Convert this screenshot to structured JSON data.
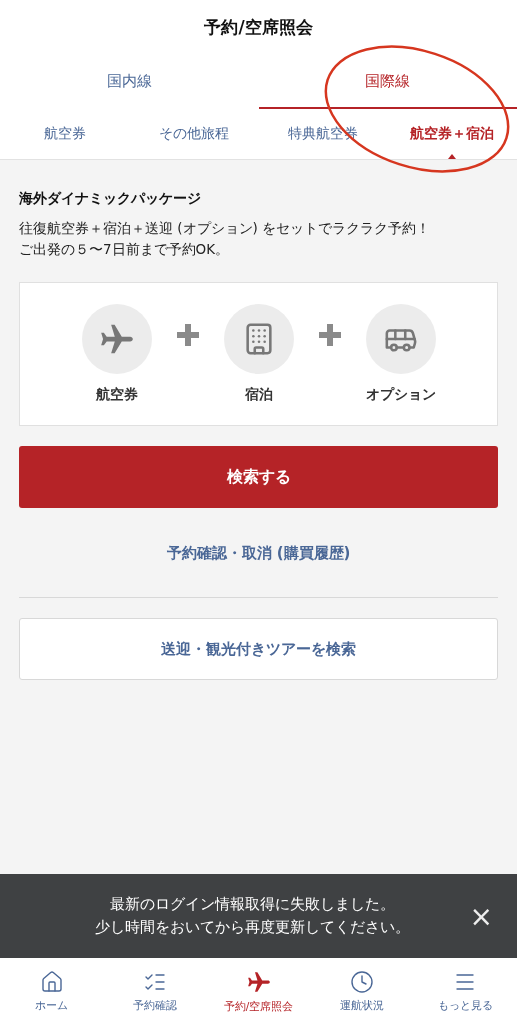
{
  "header": {
    "title": "予約/空席照会"
  },
  "tabs": [
    {
      "label": "国内線",
      "selected": false
    },
    {
      "label": "国際線",
      "selected": true
    }
  ],
  "subtabs": [
    {
      "label": "航空券",
      "selected": false
    },
    {
      "label": "その他旅程",
      "selected": false
    },
    {
      "label": "特典航空券",
      "selected": false
    },
    {
      "label": "航空券＋宿泊",
      "selected": true
    }
  ],
  "package": {
    "title": "海外ダイナミックパッケージ",
    "description": [
      "往復航空券＋宿泊＋送迎 (オプション) をセットでラクラク予約！",
      "ご出発の５〜7日前まで予約OK。"
    ],
    "items": [
      {
        "kind": "plane",
        "label": "航空券"
      },
      {
        "kind": "building",
        "label": "宿泊"
      },
      {
        "kind": "bus",
        "label": "オプション"
      }
    ]
  },
  "search_button": "検索する",
  "history_link": "予約確認・取消 (購買履歴)",
  "tour_button": "送迎・観光付きツアーを検索",
  "toast": {
    "message": [
      "最新のログイン情報取得に失敗しました。",
      "少し時間をおいてから再度更新してください。"
    ],
    "close": "×"
  },
  "nav": [
    {
      "kind": "home",
      "label": "ホーム",
      "selected": false
    },
    {
      "kind": "list",
      "label": "予約確認",
      "selected": false
    },
    {
      "kind": "plane",
      "label": "予約/空席照会",
      "selected": true
    },
    {
      "kind": "clock",
      "label": "運航状況",
      "selected": false
    },
    {
      "kind": "menu",
      "label": "もっと見る",
      "selected": false
    }
  ],
  "annotation": {
    "kind": "ellipse"
  }
}
